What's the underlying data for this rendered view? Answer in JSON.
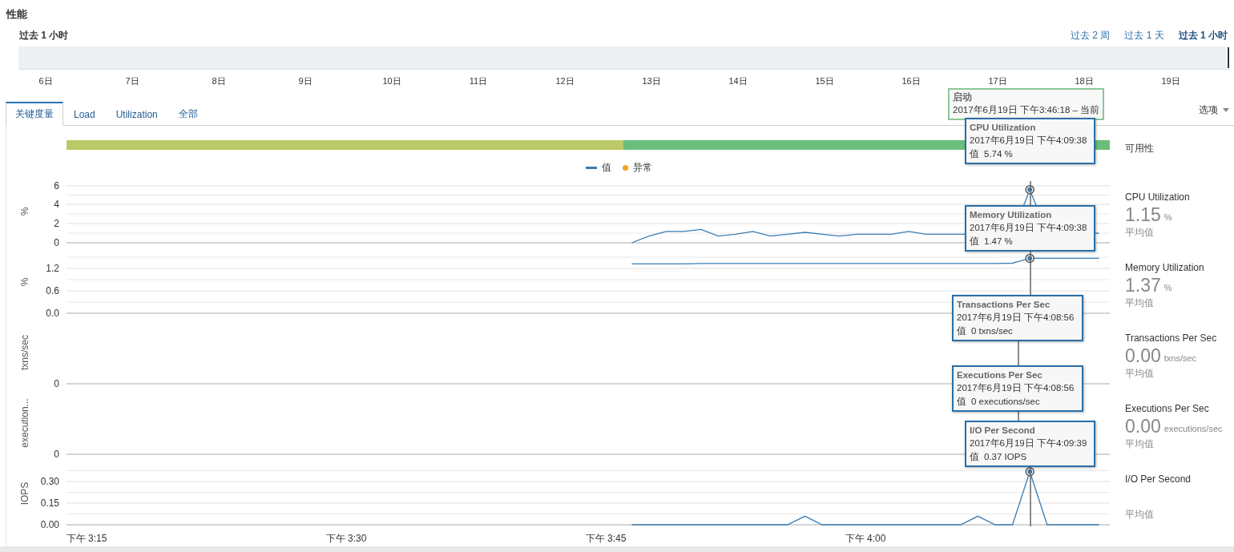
{
  "page": {
    "title": "性能"
  },
  "range": {
    "label": "过去 1 小时",
    "options": [
      {
        "label": "过去 2 周",
        "selected": false
      },
      {
        "label": "过去 1 天",
        "selected": false
      },
      {
        "label": "过去 1 小时",
        "selected": true
      }
    ]
  },
  "timeline": {
    "dates": [
      "6日",
      "7日",
      "8日",
      "9日",
      "10日",
      "11日",
      "12日",
      "13日",
      "14日",
      "15日",
      "16日",
      "17日",
      "18日",
      "19日"
    ]
  },
  "tabs": [
    {
      "label": "关键度量",
      "selected": true
    },
    {
      "label": "Load",
      "selected": false
    },
    {
      "label": "Utilization",
      "selected": false
    },
    {
      "label": "全部",
      "selected": false
    }
  ],
  "options_menu": {
    "label": "选项"
  },
  "availability": {
    "label": "可用性",
    "level": 0.534
  },
  "legend": [
    {
      "label": "值",
      "kind": "line",
      "color": "#3a7db3"
    },
    {
      "label": "异常",
      "kind": "dot",
      "color": "#f5a41f"
    }
  ],
  "start_tooltip": {
    "title": "启动",
    "text": "2017年6月19日 下午3:46:18 – 当前"
  },
  "panels": [
    {
      "kind": "line",
      "axis_title": "%",
      "y_ticks": [
        "6",
        "4",
        "2",
        "0"
      ],
      "summary": {
        "name": "CPU Utilization",
        "value": "1.15",
        "unit": "%",
        "caption": "平均值"
      },
      "tooltip": {
        "title": "CPU Utilization",
        "time": "2017年6月19日 下午4:09:38",
        "value_label": "值",
        "value": "5.74 %"
      }
    },
    {
      "kind": "line",
      "axis_title": "%",
      "y_ticks": [
        "1.2",
        "0.6",
        "0.0"
      ],
      "summary": {
        "name": "Memory Utilization",
        "value": "1.37",
        "unit": "%",
        "caption": "平均值"
      },
      "tooltip": {
        "title": "Memory Utilization",
        "time": "2017年6月19日 下午4:09:38",
        "value_label": "值",
        "value": "1.47 %"
      }
    },
    {
      "kind": "baseline",
      "axis_title": "txns/sec",
      "y_ticks": [
        "0"
      ],
      "summary": {
        "name": "Transactions Per Sec",
        "value": "0.00",
        "unit": "txns/sec",
        "caption": "平均值"
      },
      "tooltip": {
        "title": "Transactions Per Sec",
        "time": "2017年6月19日 下午4:08:56",
        "value_label": "值",
        "value": "0 txns/sec"
      }
    },
    {
      "kind": "baseline",
      "axis_title": "execution...",
      "y_ticks": [
        "0"
      ],
      "summary": {
        "name": "Executions Per Sec",
        "value": "0.00",
        "unit": "executions/sec",
        "caption": "平均值"
      },
      "tooltip": {
        "title": "Executions Per Sec",
        "time": "2017年6月19日 下午4:08:56",
        "value_label": "值",
        "value": "0 executions/sec"
      }
    },
    {
      "kind": "line",
      "axis_title": "IOPS",
      "y_ticks": [
        "0.30",
        "0.15",
        "0.00"
      ],
      "x_ticks": [
        "下午 3:15",
        "下午 3:30",
        "下午 3:45",
        "下午 4:00"
      ],
      "summary": {
        "name": "I/O Per Second",
        "caption": "平均值"
      },
      "tooltip": {
        "title": "I/O Per Second",
        "time": "2017年6月19日 下午4:09:39",
        "value_label": "值",
        "value": "0.37 IOPS"
      }
    }
  ]
}
